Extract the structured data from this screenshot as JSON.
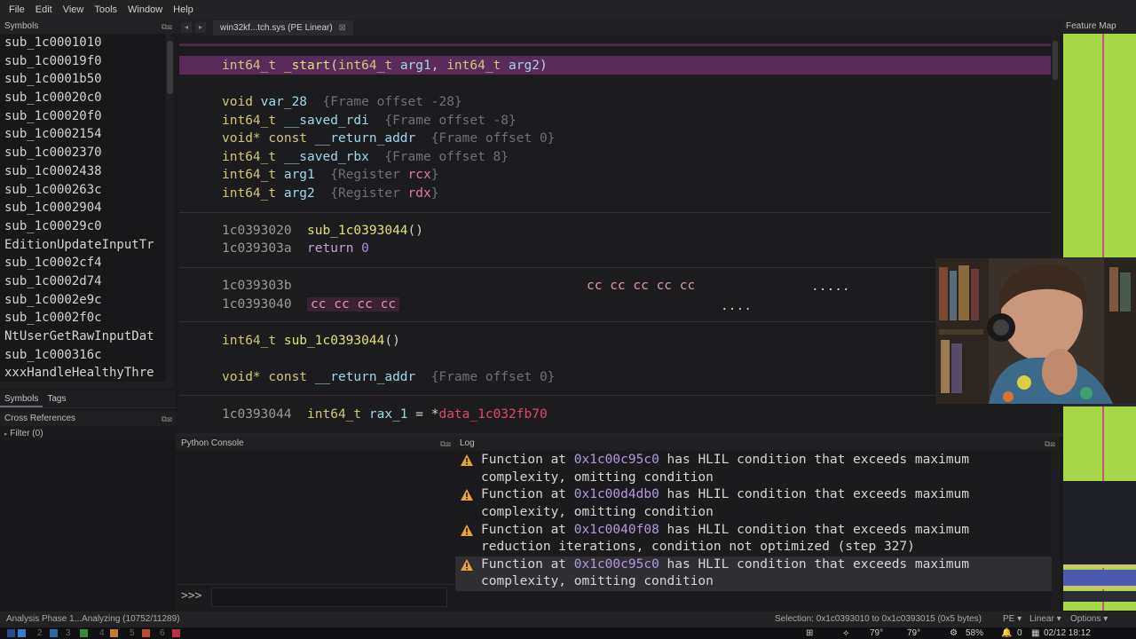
{
  "menu": [
    "File",
    "Edit",
    "View",
    "Tools",
    "Window",
    "Help"
  ],
  "symbols": {
    "header": "Symbols",
    "items": [
      "sub_1c0001010",
      "sub_1c00019f0",
      "sub_1c0001b50",
      "sub_1c00020c0",
      "sub_1c00020f0",
      "sub_1c0002154",
      "sub_1c0002370",
      "sub_1c0002438",
      "sub_1c000263c",
      "sub_1c0002904",
      "sub_1c00029c0",
      "EditionUpdateInputTr",
      "sub_1c0002cf4",
      "sub_1c0002d74",
      "sub_1c0002e9c",
      "sub_1c0002f0c",
      "NtUserGetRawInputDat",
      "sub_1c000316c",
      "xxxHandleHealthyThre"
    ]
  },
  "side_tabs": [
    "Symbols",
    "Tags"
  ],
  "xrefs": {
    "header": "Cross References",
    "filter": "Filter (0)"
  },
  "tab": {
    "title": "win32kf...tch.sys (PE Linear)",
    "close": "⊠"
  },
  "code": {
    "start_sig": {
      "type": "int64_t",
      "name": "_start",
      "open": "(",
      "t1": "int64_t",
      "a1": "arg1",
      "comma": ", ",
      "t2": "int64_t",
      "a2": "arg2",
      "close": ")"
    },
    "vars": [
      {
        "type": "void",
        "name": "var_28",
        "comment": "{Frame offset -28}"
      },
      {
        "type": "int64_t",
        "name": "__saved_rdi",
        "comment": "{Frame offset -8}"
      },
      {
        "type": "void* const",
        "name": "__return_addr",
        "comment": "{Frame offset 0}"
      },
      {
        "type": "int64_t",
        "name": "__saved_rbx",
        "comment": "{Frame offset 8}"
      },
      {
        "type": "int64_t",
        "name": "arg1",
        "comment_pre": "{Register ",
        "reg": "rcx",
        "comment_post": "}"
      },
      {
        "type": "int64_t",
        "name": "arg2",
        "comment_pre": "{Register ",
        "reg": "rdx",
        "comment_post": "}"
      }
    ],
    "body": [
      {
        "addr": "1c0393020",
        "call": "sub_1c0393044",
        "suffix": "()"
      },
      {
        "addr": "1c039303a",
        "kw": "return",
        "val": "0"
      }
    ],
    "pad": [
      {
        "addr": "1c039303b",
        "bytes": "cc cc cc cc cc",
        "dots": "....."
      },
      {
        "addr": "1c0393040",
        "bytes": "cc cc cc cc",
        "dots": "...."
      }
    ],
    "sub_sig": {
      "type": "int64_t",
      "name": "sub_1c0393044",
      "suffix": "()"
    },
    "sub_var": {
      "type": "void* const",
      "name": "__return_addr",
      "comment": "{Frame offset 0}"
    },
    "sub_line": {
      "addr": "1c0393044",
      "type": "int64_t",
      "name": "rax_1",
      "op": " = *",
      "data": "data_1c032fb70"
    }
  },
  "python_console": {
    "header": "Python Console",
    "prompt": ">>>"
  },
  "log": {
    "header": "Log",
    "entries": [
      {
        "pre": "Function at ",
        "addr": "0x1c00c95c0",
        "post": " has HLIL condition that exceeds maximum",
        "line2": "complexity, omitting condition"
      },
      {
        "pre": "Function at ",
        "addr": "0x1c00d4db0",
        "post": " has HLIL condition that exceeds maximum",
        "line2": "complexity, omitting condition"
      },
      {
        "pre": "Function at ",
        "addr": "0x1c0040f08",
        "post": " has HLIL condition that exceeds maximum",
        "line2": "reduction iterations, condition not optimized (step 327)"
      },
      {
        "pre": "Function at ",
        "addr": "0x1c00c95c0",
        "post": " has HLIL condition that exceeds maximum",
        "line2": "complexity, omitting condition"
      }
    ]
  },
  "feature_map": {
    "header": "Feature Map"
  },
  "status": {
    "left": "Analysis Phase 1...Analyzing (10752/11289)",
    "selection": "Selection: 0x1c0393010 to 0x1c0393015 (0x5 bytes)",
    "pe": "PE ▾",
    "linear": "Linear ▾",
    "options": "Options ▾"
  },
  "taskbar": {
    "workspaces": [
      "1",
      "2",
      "3",
      "4",
      "5",
      "6",
      "7"
    ],
    "temp1": "79°",
    "temp2": "79°",
    "cpu": "58%",
    "notif": "0",
    "datetime": "02/12 18:12"
  },
  "colors": {
    "accent": "#5a2a5a",
    "warning": "#e8a43c",
    "feature_map": "#a8d84a"
  }
}
